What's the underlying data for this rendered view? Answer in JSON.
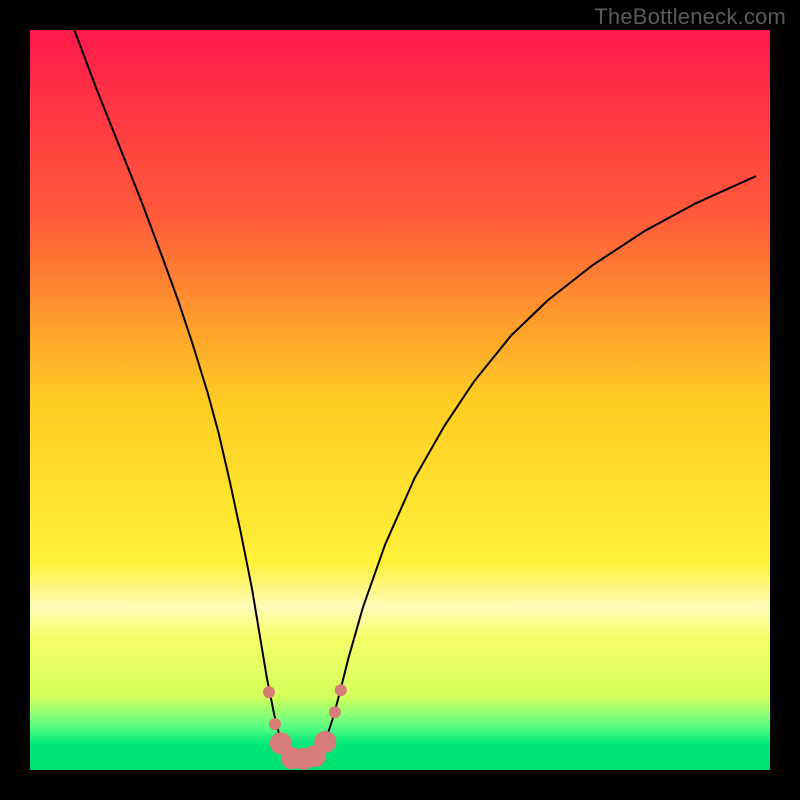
{
  "watermark": "TheBottleneck.com",
  "chart_data": {
    "type": "line",
    "title": "",
    "xlabel": "",
    "ylabel": "",
    "xlim": [
      0,
      100
    ],
    "ylim": [
      0,
      100
    ],
    "grid": false,
    "background_gradient": {
      "stops": [
        {
          "offset": 0.0,
          "color": "#ff1a4b"
        },
        {
          "offset": 0.25,
          "color": "#ff5a3a"
        },
        {
          "offset": 0.5,
          "color": "#ffcc22"
        },
        {
          "offset": 0.72,
          "color": "#fff13a"
        },
        {
          "offset": 0.78,
          "color": "#fffcb8"
        },
        {
          "offset": 0.82,
          "color": "#f7ff6a"
        },
        {
          "offset": 0.9,
          "color": "#d4ff5a"
        },
        {
          "offset": 0.94,
          "color": "#5fff84"
        },
        {
          "offset": 0.965,
          "color": "#00e878"
        },
        {
          "offset": 1.0,
          "color": "#00e070"
        }
      ]
    },
    "series": [
      {
        "name": "bottleneck-curve",
        "color": "#000000",
        "width": 2,
        "x": [
          6,
          9,
          12,
          15,
          18,
          20,
          22,
          24,
          25.5,
          27,
          28.5,
          30,
          31,
          32,
          33,
          33.8,
          34.6,
          35.4,
          36.2,
          37,
          38,
          39,
          40,
          41,
          42,
          43,
          45,
          48,
          52,
          56,
          60,
          65,
          70,
          76,
          83,
          90,
          98
        ],
        "y": [
          100,
          92,
          84.5,
          77,
          69,
          63.5,
          57.5,
          51,
          45.5,
          39,
          32,
          24.5,
          18.5,
          12.5,
          7.5,
          4.3,
          2.3,
          1.5,
          1.4,
          1.4,
          1.6,
          2.4,
          4.2,
          7.2,
          11,
          15,
          22,
          30.5,
          39.5,
          46.5,
          52.5,
          58.7,
          63.5,
          68.2,
          72.8,
          76.6,
          80.2
        ]
      }
    ],
    "markers": {
      "name": "highlighted-points",
      "color": "#d77c78",
      "radius_small": 6,
      "radius_large": 11,
      "points": [
        {
          "x": 32.3,
          "y": 10.5,
          "r": "small"
        },
        {
          "x": 33.1,
          "y": 6.2,
          "r": "small"
        },
        {
          "x": 33.9,
          "y": 3.6,
          "r": "large"
        },
        {
          "x": 35.4,
          "y": 1.6,
          "r": "large"
        },
        {
          "x": 37.0,
          "y": 1.5,
          "r": "large"
        },
        {
          "x": 38.5,
          "y": 1.9,
          "r": "large"
        },
        {
          "x": 39.9,
          "y": 3.8,
          "r": "large"
        },
        {
          "x": 41.2,
          "y": 7.8,
          "r": "small"
        },
        {
          "x": 42.0,
          "y": 10.8,
          "r": "small"
        }
      ]
    }
  }
}
